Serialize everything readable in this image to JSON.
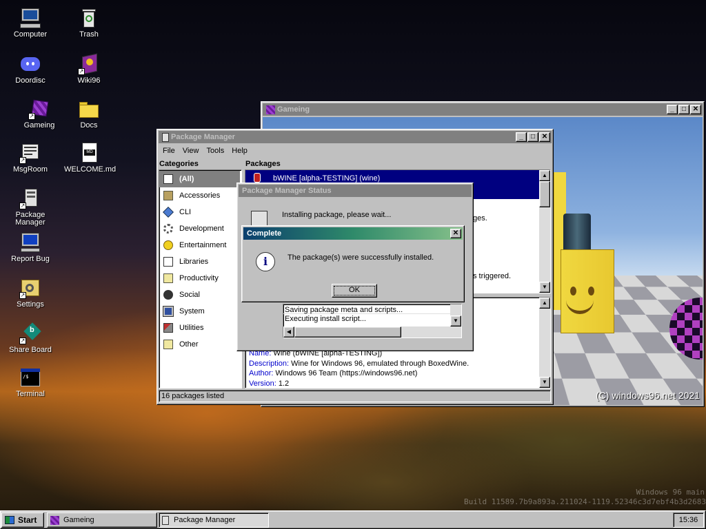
{
  "desktop": {
    "icons": [
      {
        "label": "Computer",
        "icon": "computer-icon"
      },
      {
        "label": "Trash",
        "icon": "trash-icon"
      },
      {
        "label": "Doordisc",
        "icon": "discord-icon"
      },
      {
        "label": "Wiki96",
        "icon": "wiki-book-icon"
      },
      {
        "label": "Gameing",
        "icon": "game-cube-icon"
      },
      {
        "label": "Docs",
        "icon": "folder-icon"
      },
      {
        "label": "MsgRoom",
        "icon": "msgroom-icon"
      },
      {
        "label": "WELCOME.md",
        "icon": "markdown-file-icon"
      },
      {
        "label": "Package Manager",
        "icon": "package-manager-icon"
      },
      {
        "label": "Report Bug",
        "icon": "report-bug-icon"
      },
      {
        "label": "Settings",
        "icon": "settings-icon"
      },
      {
        "label": "Share Board",
        "icon": "share-board-icon"
      },
      {
        "label": "Terminal",
        "icon": "terminal-icon"
      }
    ],
    "watermark": {
      "line1": "Windows 96 main",
      "line2": "Build 11589.7b9a893a.211024-1119.52346c3d7ebf4b3d2683"
    }
  },
  "game_window": {
    "title": "Gameing",
    "copyright": "(C) windows96.net 2021"
  },
  "package_manager": {
    "title": "Package Manager",
    "menu": [
      "File",
      "View",
      "Tools",
      "Help"
    ],
    "categories_header": "Categories",
    "packages_header": "Packages",
    "categories": [
      "(All)",
      "Accessories",
      "CLI",
      "Development",
      "Entertainment",
      "Libraries",
      "Productivity",
      "Social",
      "System",
      "Utilities",
      "Other"
    ],
    "selected_package": "bWINE [alpha-TESTING] (wine)",
    "partial_texts": [
      "ges.",
      "s triggered."
    ],
    "details": {
      "name_label": "Name:",
      "name_value": "Wine (bWINE [alpha-TESTING])",
      "description_label": "Description:",
      "description_value": "Wine for Windows 96, emulated through BoxedWine.",
      "author_label": "Author:",
      "author_value": "Windows 96 Team (https://windows96.net)",
      "version_label": "Version:",
      "version_value": "1.2"
    },
    "status": "16 packages listed"
  },
  "status_dialog": {
    "title": "Package Manager Status",
    "message": "Installing package, please wait...",
    "log": [
      "Saving package meta and scripts...",
      "Executing install script..."
    ]
  },
  "complete_dialog": {
    "title": "Complete",
    "message": "The package(s) were successfully installed.",
    "ok_label": "OK"
  },
  "taskbar": {
    "start_label": "Start",
    "tasks": [
      "Gameing",
      "Package Manager"
    ],
    "clock": "15:36"
  },
  "colors": {
    "titlebar_active": "#000080",
    "selection": "#000080",
    "link_blue": "#0000cc"
  }
}
